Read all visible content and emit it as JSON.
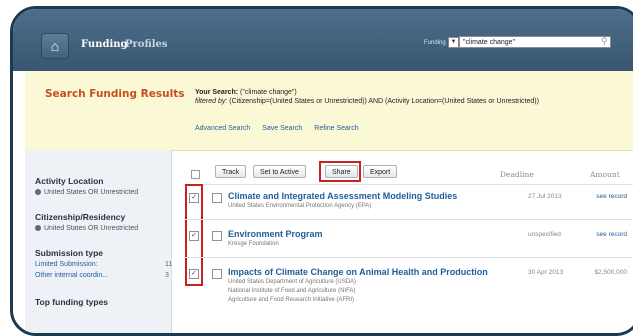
{
  "header": {
    "home_icon": "home-icon",
    "tabs": [
      {
        "label": "Funding",
        "active": true
      },
      {
        "label": "Profiles",
        "active": false
      }
    ],
    "search_scope": "Funding",
    "search_value": "\"climate change\""
  },
  "summary": {
    "title": "Search Funding Results",
    "your_search_label": "Your Search:",
    "your_search_query": "(\"climate change\")",
    "filtered_label": "filtered by:",
    "filtered_text": "(Citizenship=(United States or Unrestricted)) AND (Activity Location=(United States or Unrestricted))",
    "links": [
      "Advanced Search",
      "Save Search",
      "Refine Search"
    ]
  },
  "sidebar": {
    "facets": [
      {
        "heading": "Activity Location",
        "value": "United States OR Unrestricted"
      },
      {
        "heading": "Citizenship/Residency",
        "value": "United States OR Unrestricted"
      }
    ],
    "submission": {
      "heading": "Submission type",
      "items": [
        {
          "label": "Limited Submission:",
          "count": "11"
        },
        {
          "label": "Other internal coordin...",
          "count": "3"
        }
      ]
    },
    "top_funding": "Top funding types"
  },
  "toolbar": {
    "buttons": [
      "Track",
      "Set to Active",
      "Share",
      "Export"
    ],
    "col_deadline": "Deadline",
    "col_amount": "Amount"
  },
  "results": [
    {
      "title": "Climate and Integrated Assessment Modeling Studies",
      "sponsors": [
        "United States Environmental Protection Agency (EPA)"
      ],
      "deadline": "27 Jul 2013",
      "amount": "see record",
      "checked": true
    },
    {
      "title": "Environment Program",
      "sponsors": [
        "Kresge Foundation"
      ],
      "deadline": "unspecified",
      "amount": "see record",
      "checked": true
    },
    {
      "title": "Impacts of Climate Change on Animal Health and Production",
      "sponsors": [
        "United States Department of Agriculture (USDA)",
        "National Institute of Food and Agriculture (NIFA)",
        "Agriculture and Food Research Initiative (AFRI)"
      ],
      "deadline": "30 Apr 2013",
      "amount": "$2,500,000",
      "checked": true
    }
  ],
  "colors": {
    "topbar": "#41607a",
    "accent_orange": "#c8501e",
    "link_blue": "#1f5e9e",
    "highlight_red": "#cc2020",
    "summary_bg": "#fbf8d6"
  }
}
